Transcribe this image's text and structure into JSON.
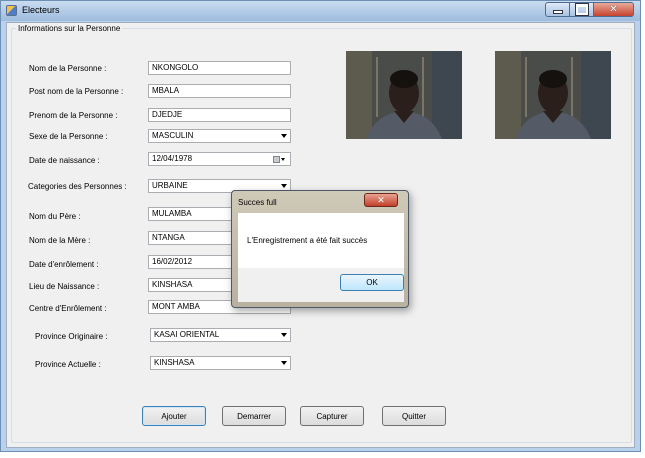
{
  "window": {
    "title": "Electeurs"
  },
  "group": {
    "legend": "Informations sur la Personne"
  },
  "form": {
    "nom_label": "Nom de la Personne :",
    "nom_value": "NKONGOLO",
    "postnom_label": "Post nom de la Personne :",
    "postnom_value": "MBALA",
    "prenom_label": "Prenom de la Personne :",
    "prenom_value": "DJEDJE",
    "sexe_label": "Sexe de la Personne :",
    "sexe_value": "MASCULIN",
    "naissance_label": "Date de naissance :",
    "naissance_value": "12/04/1978",
    "categorie_label": "Categories des Personnes :",
    "categorie_value": "URBAINE",
    "pere_label": "Nom du Père :",
    "pere_value": "MULAMBA",
    "mere_label": "Nom de la Mère :",
    "mere_value": "NTANGA",
    "enrolement_date_label": "Date d'enrôlement :",
    "enrolement_date_value": "16/02/2012",
    "lieu_label": "Lieu de Naissance :",
    "lieu_value": "KINSHASA",
    "centre_label": "Centre d'Enrôlement :",
    "centre_value": "MONT AMBA",
    "province_orig_label": "Province Originaire :",
    "province_orig_value": "KASAI ORIENTAL",
    "province_act_label": "Province Actuelle :",
    "province_act_value": "KINSHASA"
  },
  "buttons": {
    "ajouter": "Ajouter",
    "demarrer": "Demarrer",
    "capturer": "Capturer",
    "quitter": "Quitter"
  },
  "dialog": {
    "title": "Succes full",
    "message": "L'Enregistrement a été fait succès",
    "ok": "OK"
  },
  "icons": {
    "app": "app-icon",
    "minimize": "minimize-icon",
    "maximize": "maximize-icon",
    "close": "close-icon",
    "dropdown": "chevron-down-icon",
    "calendar": "calendar-icon"
  }
}
